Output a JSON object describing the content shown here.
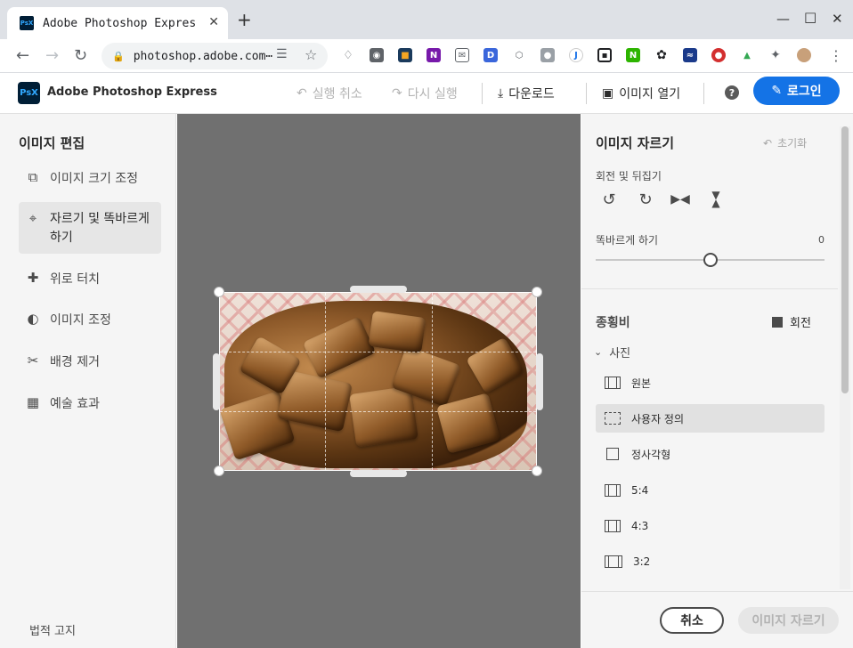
{
  "browser": {
    "tab_title": "Adobe Photoshop Express",
    "favicon_text": "PsX",
    "url": "photoshop.adobe.com⋯",
    "new_tab": "+",
    "tab_close": "✕"
  },
  "app": {
    "logo_text": "PsX",
    "title": "Adobe Photoshop Express",
    "toolbar": {
      "undo": "실행 취소",
      "redo": "다시 실행",
      "download": "다운로드",
      "open_image": "이미지 열기",
      "help": "?",
      "login": "로그인"
    }
  },
  "left_panel": {
    "title": "이미지 편집",
    "items": [
      {
        "label": "이미지 크기 조정",
        "icon": "resize-icon"
      },
      {
        "label": "자르기 및 똑바르게 하기",
        "icon": "crop-icon"
      },
      {
        "label": "위로 터치",
        "icon": "bandage-icon"
      },
      {
        "label": "이미지 조정",
        "icon": "adjust-icon"
      },
      {
        "label": "배경 제거",
        "icon": "remove-bg-icon"
      },
      {
        "label": "예술 효과",
        "icon": "art-effect-icon"
      }
    ],
    "legal": "법적 고지"
  },
  "right_panel": {
    "title": "이미지 자르기",
    "reset": "초기화",
    "rotate_flip_label": "회전 및 뒤집기",
    "straighten_label": "똑바르게 하기",
    "straighten_value": "0",
    "aspect_title": "종횡비",
    "rotate_label": "회전",
    "photo_group": "사진",
    "aspect_items": [
      "원본",
      "사용자 정의",
      "정사각형",
      "5:4",
      "4:3",
      "3:2"
    ],
    "cancel": "취소",
    "crop": "이미지 자르기"
  }
}
